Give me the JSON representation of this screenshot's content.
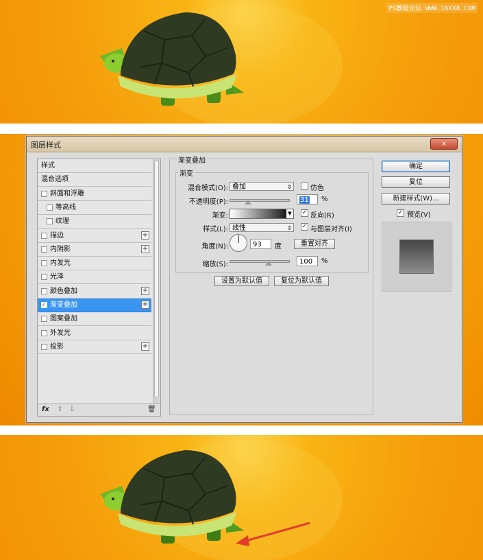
{
  "watermark": "PS教程论坛 WWW.16XX8.COM",
  "dialog": {
    "title": "图层样式",
    "close_label": "x",
    "list_items": [
      {
        "label": "样式",
        "checkbox": false,
        "checked": false,
        "plus": false,
        "selected": false,
        "indent": 0
      },
      {
        "label": "混合选项",
        "checkbox": false,
        "checked": false,
        "plus": false,
        "selected": false,
        "indent": 0
      },
      {
        "label": "斜面和浮雕",
        "checkbox": true,
        "checked": false,
        "plus": false,
        "selected": false,
        "indent": 0
      },
      {
        "label": "等高线",
        "checkbox": true,
        "checked": false,
        "plus": false,
        "selected": false,
        "indent": 1
      },
      {
        "label": "纹理",
        "checkbox": true,
        "checked": false,
        "plus": false,
        "selected": false,
        "indent": 1
      },
      {
        "label": "描边",
        "checkbox": true,
        "checked": false,
        "plus": true,
        "selected": false,
        "indent": 0
      },
      {
        "label": "内阴影",
        "checkbox": true,
        "checked": false,
        "plus": true,
        "selected": false,
        "indent": 0
      },
      {
        "label": "内发光",
        "checkbox": true,
        "checked": false,
        "plus": false,
        "selected": false,
        "indent": 0
      },
      {
        "label": "光泽",
        "checkbox": true,
        "checked": false,
        "plus": false,
        "selected": false,
        "indent": 0
      },
      {
        "label": "颜色叠加",
        "checkbox": true,
        "checked": false,
        "plus": true,
        "selected": false,
        "indent": 0
      },
      {
        "label": "渐变叠加",
        "checkbox": true,
        "checked": true,
        "plus": true,
        "selected": true,
        "indent": 0
      },
      {
        "label": "图案叠加",
        "checkbox": true,
        "checked": false,
        "plus": false,
        "selected": false,
        "indent": 0
      },
      {
        "label": "外发光",
        "checkbox": true,
        "checked": false,
        "plus": false,
        "selected": false,
        "indent": 0
      },
      {
        "label": "投影",
        "checkbox": true,
        "checked": false,
        "plus": true,
        "selected": false,
        "indent": 0
      }
    ],
    "footer": {
      "fx": "fx",
      "up": "⇧",
      "down": "⇩",
      "trash": "🗑"
    },
    "panel": {
      "group_title": "渐变叠加",
      "sub_title": "渐变",
      "blend_mode_label": "混合模式(O):",
      "blend_mode_value": "叠加",
      "dither_label": "仿色",
      "opacity_label": "不透明度(P):",
      "opacity_value": "31",
      "opacity_unit": "%",
      "gradient_label": "渐变:",
      "reverse_label": "反向(R)",
      "style_label": "样式(L):",
      "style_value": "线性",
      "align_label": "与图层对齐(I)",
      "angle_label": "角度(N):",
      "angle_value": "93",
      "angle_unit": "度",
      "reset_align_label": "重置对齐",
      "scale_label": "缩放(S):",
      "scale_value": "100",
      "scale_unit": "%",
      "set_default_label": "设置为默认值",
      "reset_default_label": "复位为默认值"
    },
    "right": {
      "ok_label": "确定",
      "reset_label": "复位",
      "new_style_label": "新建样式(W)...",
      "preview_label": "预览(V)"
    }
  },
  "colors": {
    "background_orange": "#f59e0b",
    "selection_blue": "#3a95f2",
    "arrow_red": "#e23b2e"
  }
}
